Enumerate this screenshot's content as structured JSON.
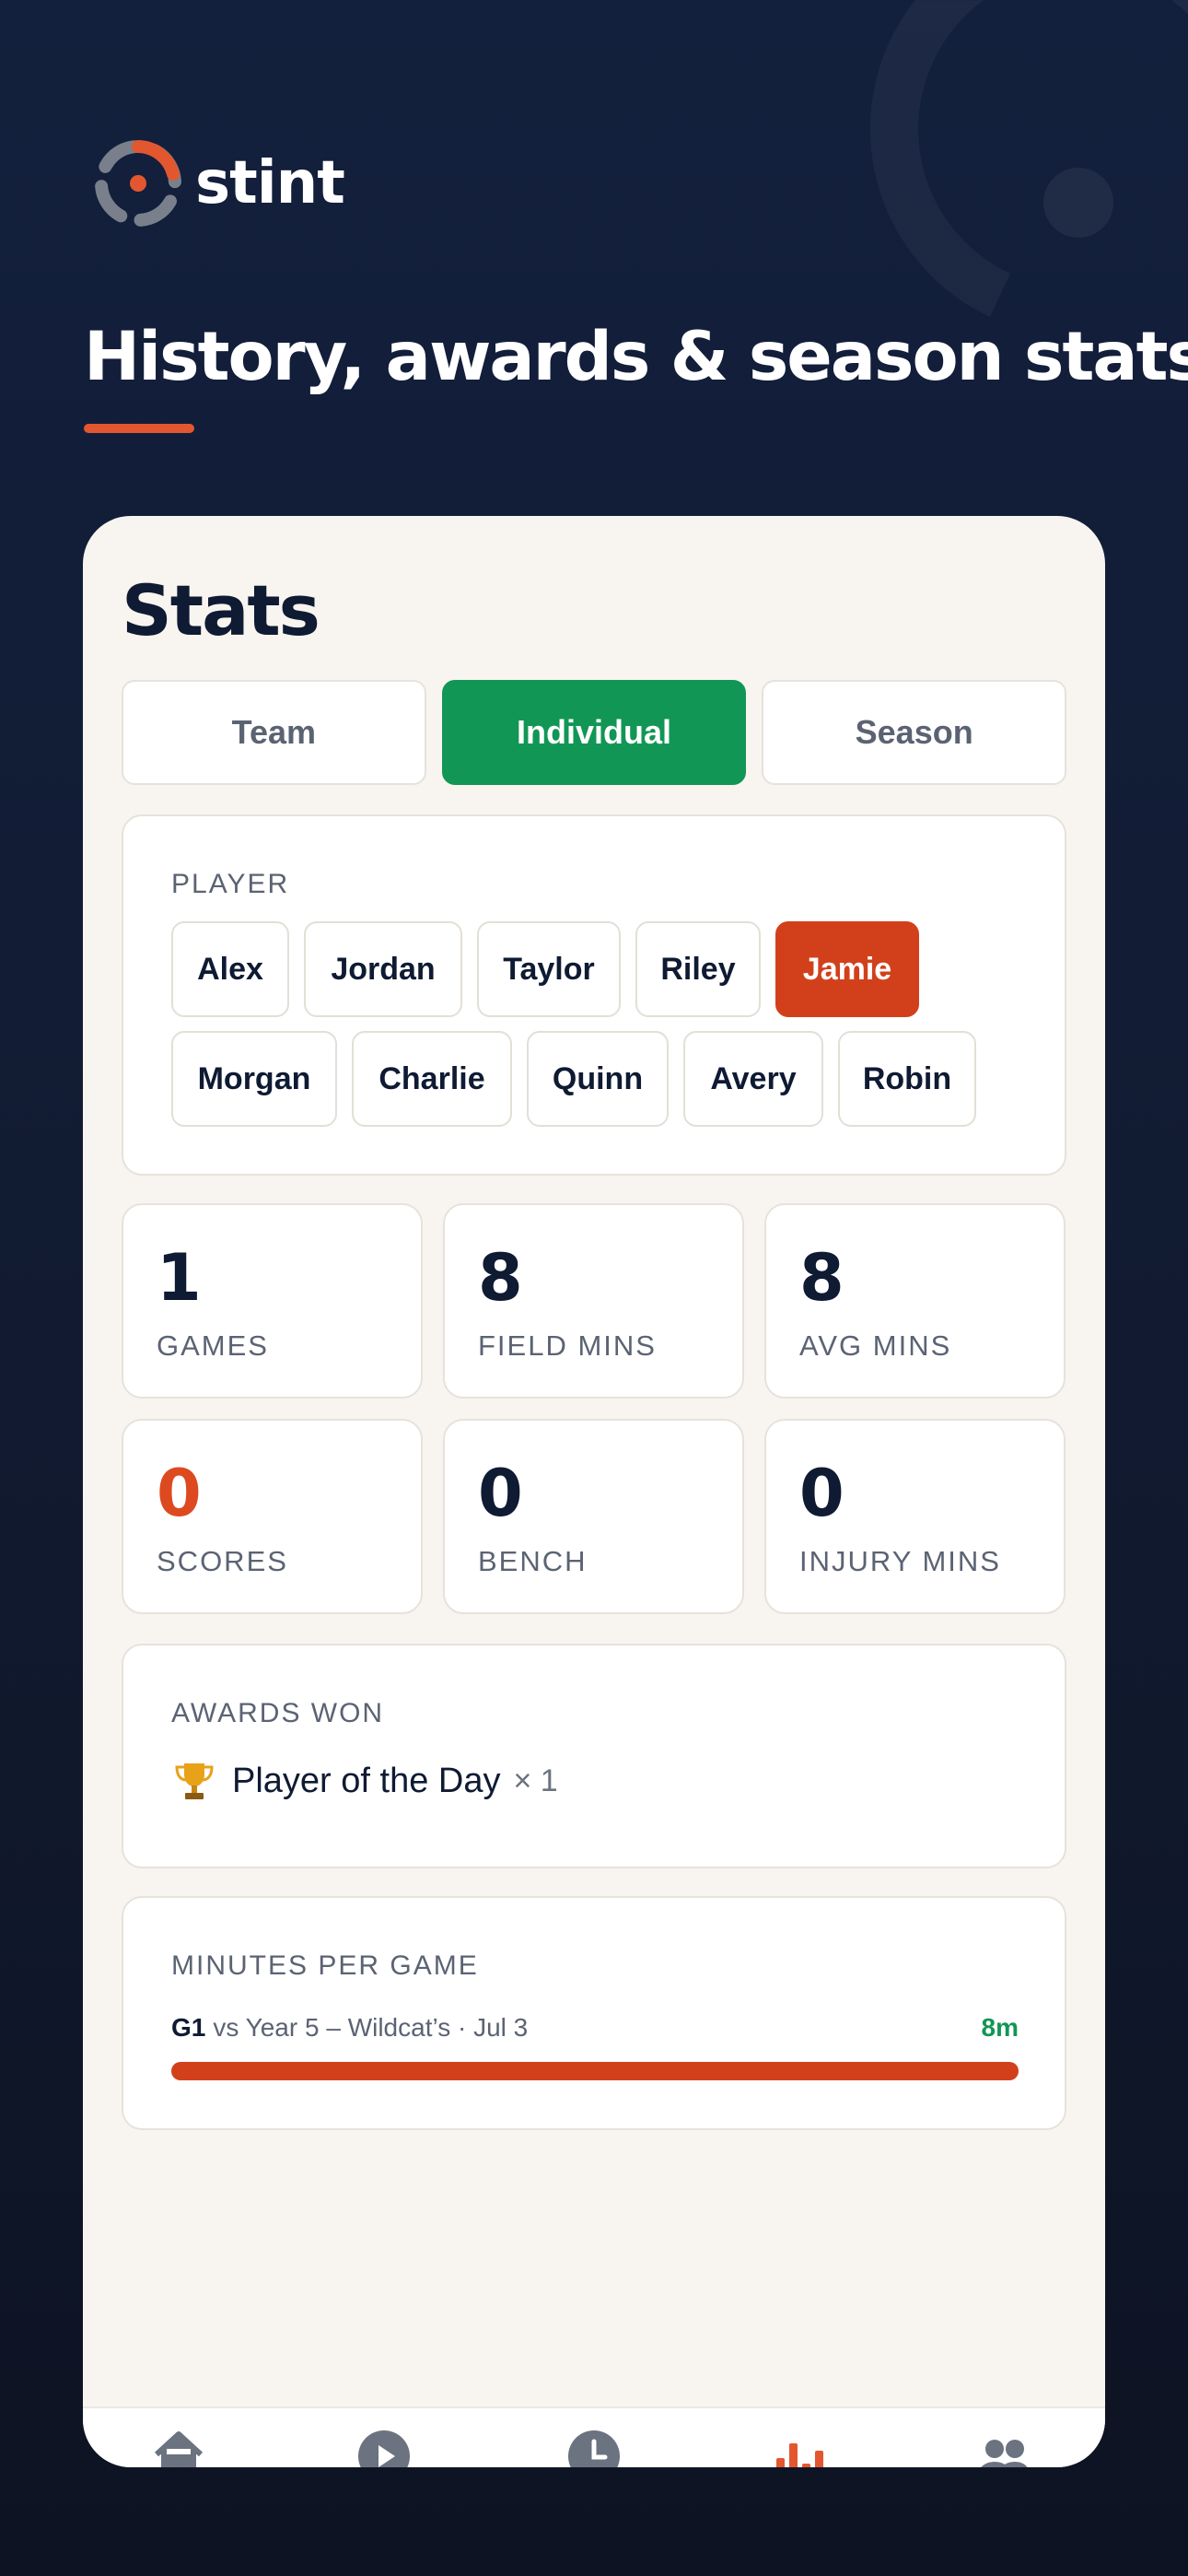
{
  "brand": {
    "name": "stint",
    "accent": "#e2572f"
  },
  "headline": "History, awards & season stats",
  "screen": {
    "title": "Stats",
    "tabs": [
      {
        "label": "Team",
        "active": false
      },
      {
        "label": "Individual",
        "active": true
      },
      {
        "label": "Season",
        "active": false
      }
    ],
    "player_section": {
      "label": "PLAYER",
      "players": [
        "Alex",
        "Jordan",
        "Taylor",
        "Riley",
        "Jamie",
        "Morgan",
        "Charlie",
        "Quinn",
        "Avery",
        "Robin"
      ],
      "selected": "Jamie"
    },
    "stats": [
      {
        "value": "1",
        "label": "GAMES"
      },
      {
        "value": "8",
        "label": "FIELD MINS"
      },
      {
        "value": "8",
        "label": "AVG MINS"
      },
      {
        "value": "0",
        "label": "SCORES",
        "color": "#dd4a1f"
      },
      {
        "value": "0",
        "label": "BENCH"
      },
      {
        "value": "0",
        "label": "INJURY MINS"
      }
    ],
    "awards": {
      "label": "AWARDS WON",
      "items": [
        {
          "icon": "trophy-icon",
          "name": "Player of the Day",
          "count": "× 1"
        }
      ]
    },
    "minutes_per_game": {
      "label": "MINUTES PER GAME",
      "games": [
        {
          "id": "G1",
          "description": "vs Year 5 – Wildcat’s · Jul 3",
          "minutes_label": "8m",
          "fill_fraction": 1.0
        }
      ]
    },
    "nav": [
      {
        "icon": "home-icon"
      },
      {
        "icon": "play-icon"
      },
      {
        "icon": "clock-icon"
      },
      {
        "icon": "stats-icon",
        "active": true
      },
      {
        "icon": "team-icon"
      }
    ]
  },
  "colors": {
    "background": "#13203d",
    "active_tab": "#129655",
    "selected_chip": "#d2401b",
    "nav_active": "#e2572f",
    "nav_inactive": "#6b7280"
  }
}
